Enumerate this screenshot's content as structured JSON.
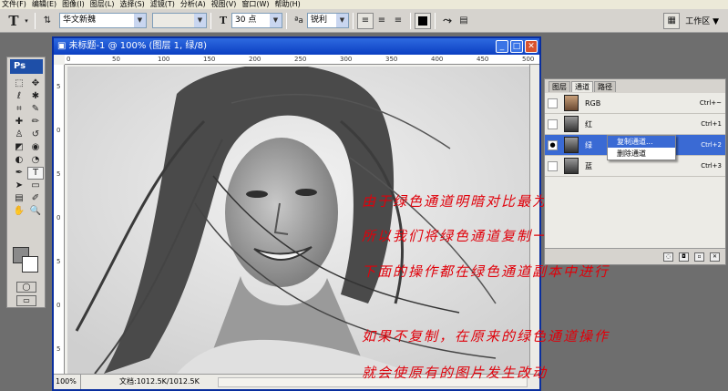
{
  "menu": [
    "文件(F)",
    "编辑(E)",
    "图像(I)",
    "图层(L)",
    "选择(S)",
    "滤镜(T)",
    "分析(A)",
    "视图(V)",
    "窗口(W)",
    "帮助(H)"
  ],
  "options": {
    "font_family": "华文新魏",
    "font_style": "",
    "font_size": "30 点",
    "anti_alias": "锐利",
    "workspace": "工作区"
  },
  "tools": {
    "logo": "Ps",
    "icons": [
      "marquee-icon",
      "move-icon",
      "lasso-icon",
      "magic-wand-icon",
      "crop-icon",
      "slice-icon",
      "healing-icon",
      "brush-icon",
      "stamp-icon",
      "history-brush-icon",
      "eraser-icon",
      "bucket-icon",
      "blur-icon",
      "dodge-icon",
      "pen-icon",
      "type-icon",
      "path-select-icon",
      "shape-icon",
      "notes-icon",
      "eyedropper-icon",
      "hand-icon",
      "zoom-icon"
    ],
    "glyphs": [
      "⬚",
      "✥",
      "ℓ",
      "✱",
      "⌗",
      "✎",
      "✚",
      "✏",
      "♙",
      "↺",
      "◩",
      "◉",
      "◐",
      "◔",
      "✒",
      "T",
      "➤",
      "▭",
      "▤",
      "✐",
      "✋",
      "🔍"
    ],
    "active_index": 15
  },
  "document": {
    "title": "未标题-1 @ 100% (图层 1, 绿/8)",
    "zoom": "100%",
    "doc_info": "文档:1012.5K/1012.5K",
    "ruler_top": [
      "0",
      "50",
      "100",
      "150",
      "200",
      "250",
      "300",
      "350",
      "400",
      "450",
      "500"
    ],
    "ruler_left": [
      "5",
      "0",
      "5",
      "0",
      "5",
      "0",
      "5"
    ]
  },
  "notes": [
    "由于绿色通道明暗对比最为明显",
    "所以我们将绿色通道复制一份",
    "下面的操作都在绿色通道副本中进行",
    "如果不复制，在原来的绿色通道操作",
    "就会使原有的图片发生改动"
  ],
  "panel": {
    "tabs": [
      "图层",
      "通道",
      "路径"
    ],
    "selected_tab": 1,
    "channels": [
      {
        "name": "RGB",
        "shortcut": "Ctrl+~",
        "visible": false,
        "selected": false
      },
      {
        "name": "红",
        "shortcut": "Ctrl+1",
        "visible": false,
        "selected": false
      },
      {
        "name": "绿",
        "shortcut": "Ctrl+2",
        "visible": true,
        "selected": true
      },
      {
        "name": "蓝",
        "shortcut": "Ctrl+3",
        "visible": false,
        "selected": false
      }
    ]
  },
  "context_menu": [
    "复制通道...",
    "删除通道"
  ],
  "colors": {
    "note": "#e0000a",
    "selection": "#3a6ad4",
    "titlebar": "#0b3fc2"
  }
}
